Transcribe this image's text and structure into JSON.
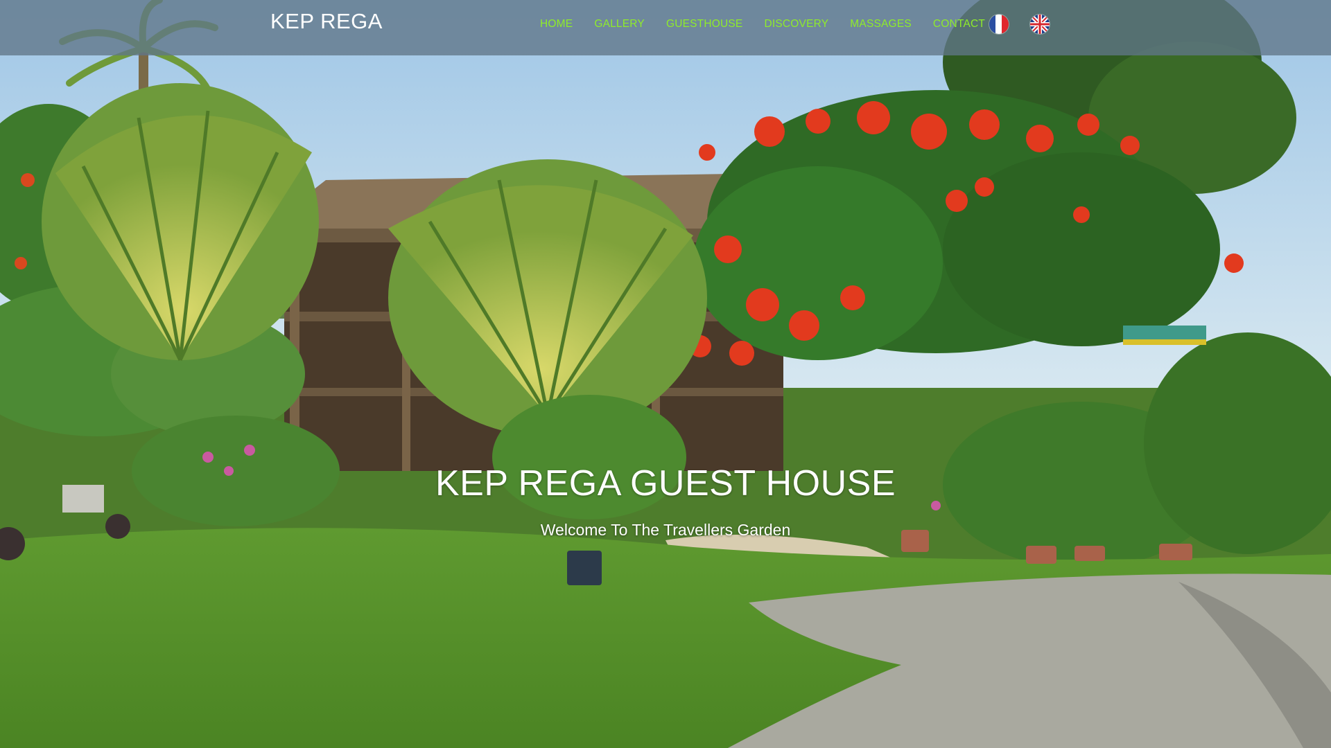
{
  "brand": "KEP REGA",
  "nav": {
    "items": [
      {
        "label": "HOME"
      },
      {
        "label": "GALLERY"
      },
      {
        "label": "GUESTHOUSE"
      },
      {
        "label": "DISCOVERY"
      },
      {
        "label": "MASSAGES"
      },
      {
        "label": "CONTACT"
      }
    ],
    "languages": [
      {
        "icon": "france-flag-icon"
      },
      {
        "icon": "uk-flag-icon"
      }
    ],
    "link_color": "#8fec2a",
    "bar_color": "#607688"
  },
  "hero": {
    "title": "KEP REGA GUEST HOUSE",
    "subtitle": "Welcome To The Travellers Garden",
    "image": "guesthouse-garden-photo"
  }
}
